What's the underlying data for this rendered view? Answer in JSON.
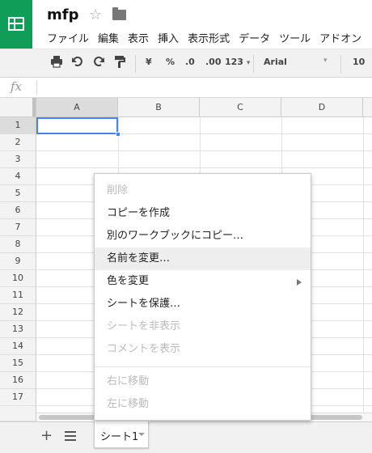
{
  "header": {
    "title": "mfp",
    "star_glyph": "☆",
    "menus": [
      "ファイル",
      "編集",
      "表示",
      "挿入",
      "表示形式",
      "データ",
      "ツール",
      "アドオン"
    ]
  },
  "toolbar": {
    "currency": "¥",
    "percent": "%",
    "dec_decrease": ".0",
    "dec_increase": ".00",
    "number_format": "123",
    "number_format_arrow": "▾",
    "font": "Arial",
    "font_arrow": "▾",
    "font_size": "10"
  },
  "formula_bar": {
    "fx": "fx",
    "value": ""
  },
  "grid": {
    "columns": [
      "A",
      "B",
      "C",
      "D"
    ],
    "rows": [
      "1",
      "2",
      "3",
      "4",
      "5",
      "6",
      "7",
      "8",
      "9",
      "10",
      "11",
      "12",
      "13",
      "14",
      "15",
      "16",
      "17"
    ],
    "selected_cell": "A1"
  },
  "context_menu": {
    "items": [
      {
        "label": "削除",
        "disabled": true
      },
      {
        "label": "コピーを作成",
        "disabled": false
      },
      {
        "label": "別のワークブックにコピー…",
        "disabled": false
      },
      {
        "label": "名前を変更…",
        "disabled": false,
        "highlighted": true
      },
      {
        "label": "色を変更",
        "disabled": false,
        "submenu": true
      },
      {
        "label": "シートを保護…",
        "disabled": false
      },
      {
        "label": "シートを非表示",
        "disabled": true
      },
      {
        "label": "コメントを表示",
        "disabled": true
      },
      {
        "label": "右に移動",
        "disabled": true
      },
      {
        "label": "左に移動",
        "disabled": true
      }
    ]
  },
  "sheet_bar": {
    "add_glyph": "+",
    "tabs": [
      {
        "label": "シート1",
        "active": true
      }
    ]
  },
  "colors": {
    "brand_green": "#0f9d58",
    "selection_blue": "#4285f4",
    "menu_hover": "#eeeeee"
  }
}
